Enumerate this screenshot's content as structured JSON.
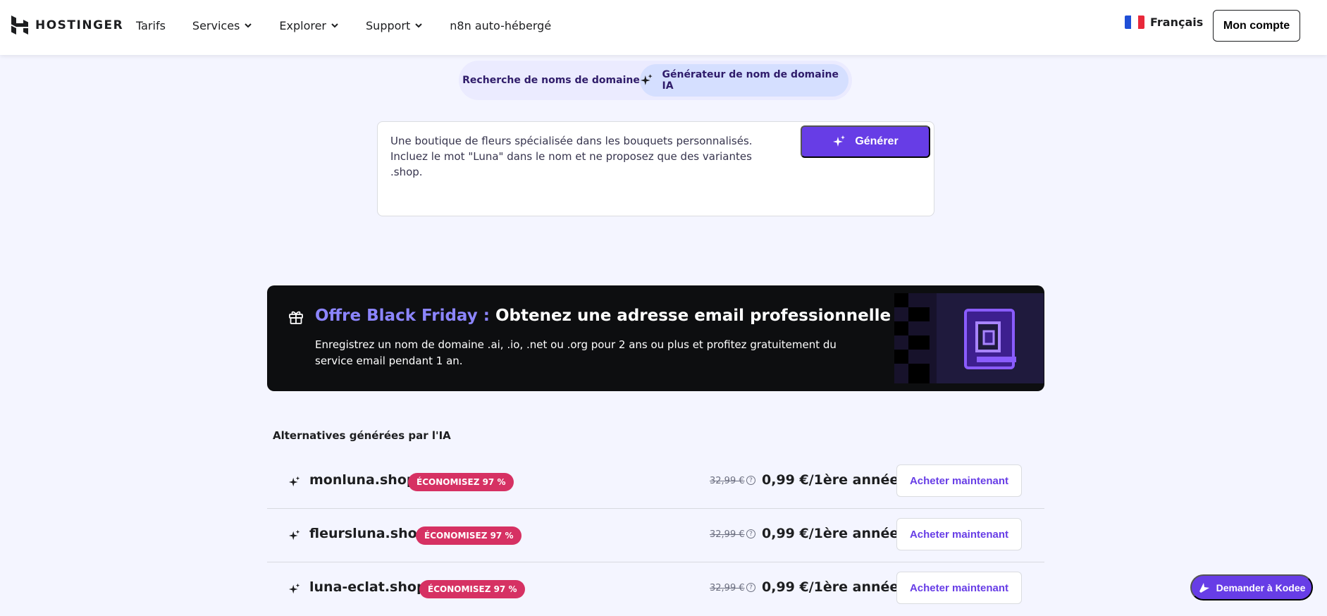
{
  "brand": {
    "name": "HOSTINGER"
  },
  "nav": {
    "items": [
      {
        "label": "Tarifs",
        "dropdown": false
      },
      {
        "label": "Services",
        "dropdown": true
      },
      {
        "label": "Explorer",
        "dropdown": true
      },
      {
        "label": "Support",
        "dropdown": true
      },
      {
        "label": "n8n auto-hébergé",
        "dropdown": false
      }
    ],
    "language": "Français",
    "account_label": "Mon compte"
  },
  "tabs": {
    "search_label": "Recherche de noms de domaine",
    "ai_label": "Générateur de nom de domaine IA",
    "active": "ai"
  },
  "prompt": {
    "value": "Une boutique de fleurs spécialisée dans les bouquets personnalisés. Incluez le mot \"Luna\" dans le nom et ne proposez que des variantes .shop.",
    "generate_label": "Générer"
  },
  "promo": {
    "highlight": "Offre Black Friday :",
    "title": "Obtenez une adresse email professionnelle gratuite",
    "body": "Enregistrez un nom de domaine .ai, .io, .net ou .org pour 2 ans ou plus et profitez gratuitement du service email pendant 1 an."
  },
  "results": {
    "title": "Alternatives générées par l'IA",
    "items": [
      {
        "domain": "monluna.shop",
        "badge": "ÉCONOMISEZ 97 %",
        "old_price": "32,99 €",
        "price": "0,99 €/1ère année",
        "cta": "Acheter maintenant"
      },
      {
        "domain": "fleursluna.shop",
        "badge": "ÉCONOMISEZ 97 %",
        "old_price": "32,99 €",
        "price": "0,99 €/1ère année",
        "cta": "Acheter maintenant"
      },
      {
        "domain": "luna-eclat.shop",
        "badge": "ÉCONOMISEZ 97 %",
        "old_price": "32,99 €",
        "price": "0,99 €/1ère année",
        "cta": "Acheter maintenant"
      }
    ]
  },
  "assistant": {
    "label": "Demander à Kodee"
  },
  "colors": {
    "accent": "#673de6",
    "badge": "#d63163",
    "promo_bg": "#0d0e10",
    "promo_highlight": "#8c85ff"
  }
}
